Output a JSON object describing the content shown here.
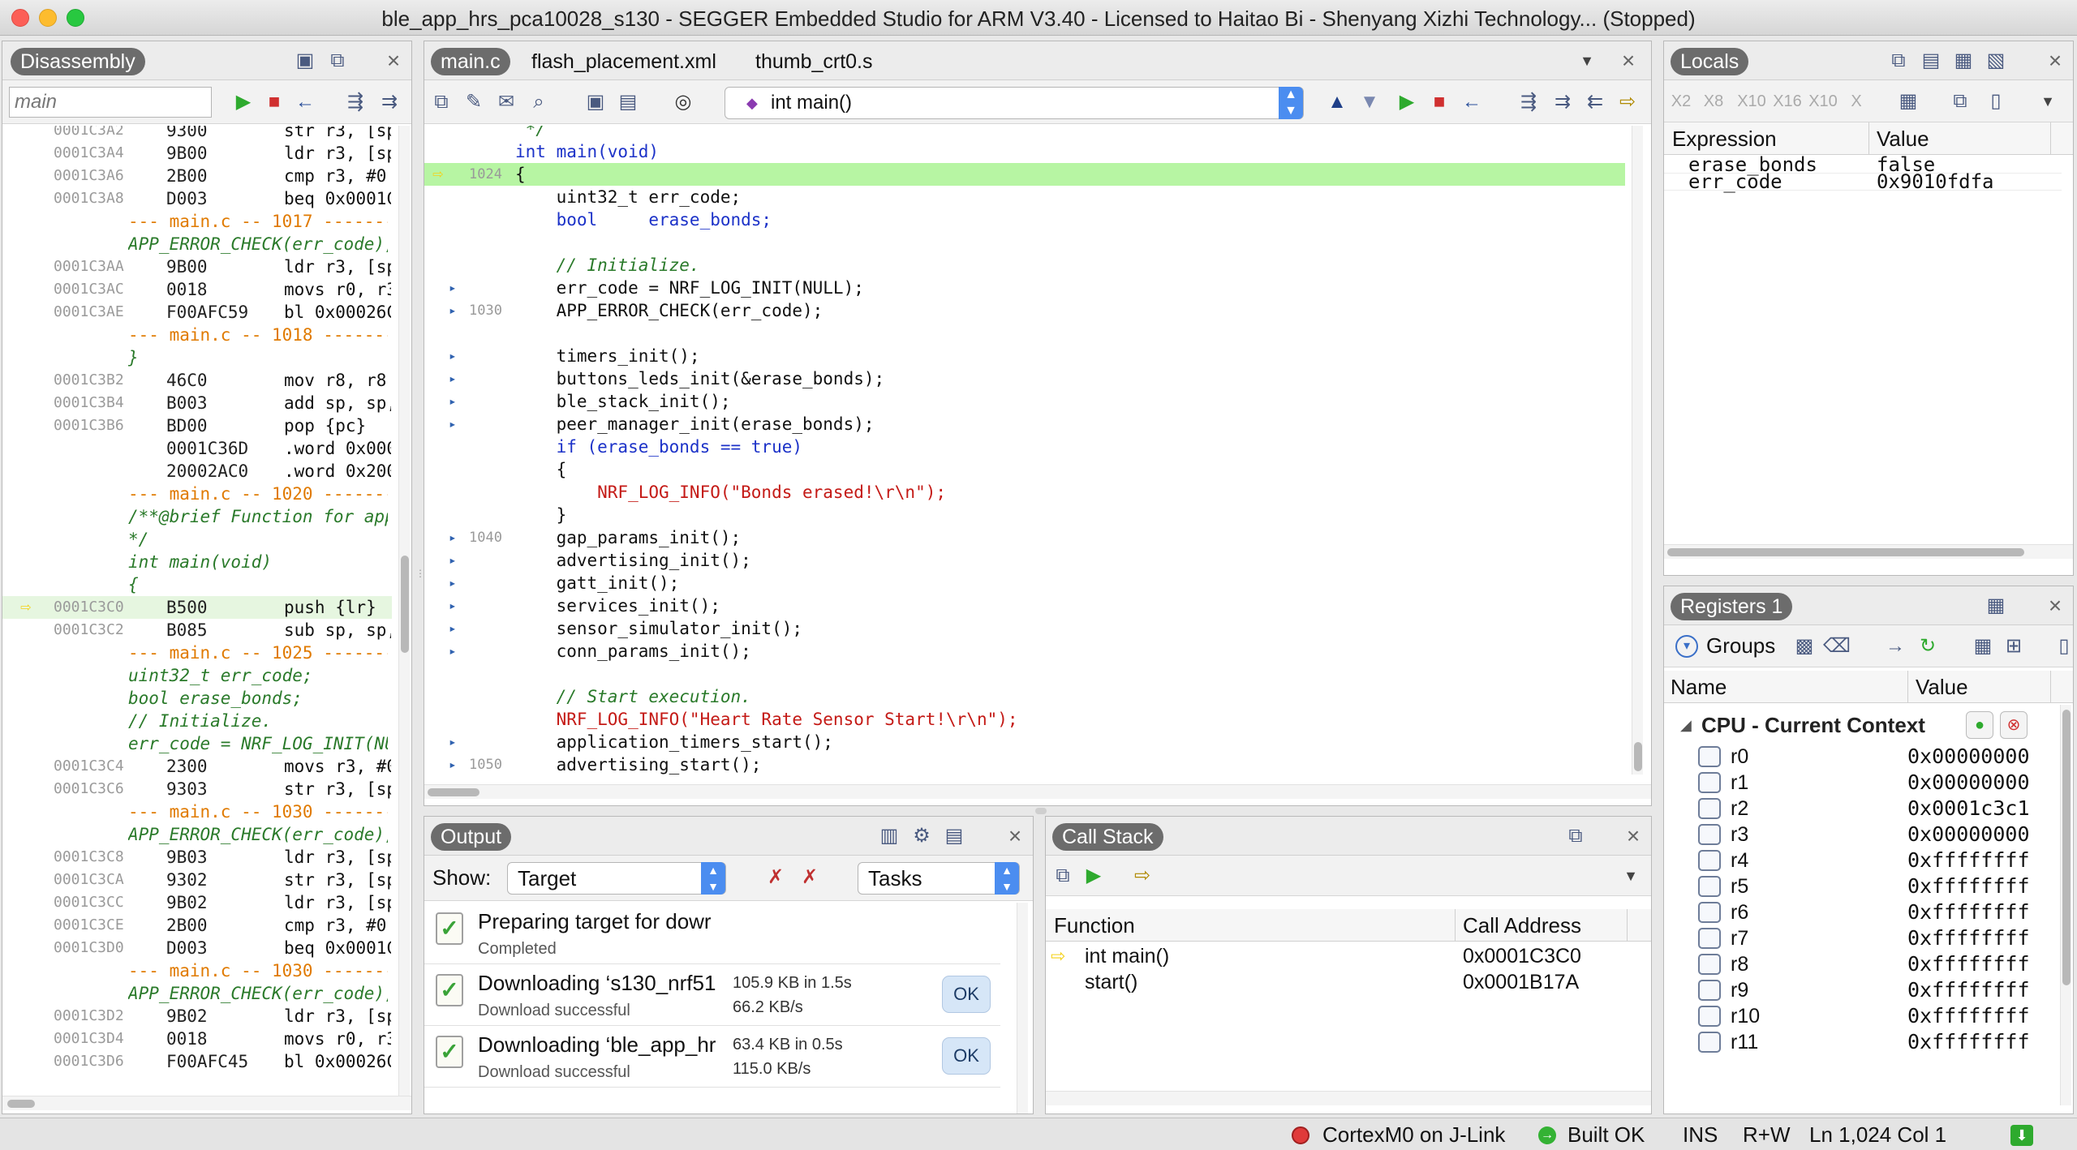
{
  "window": {
    "title": "ble_app_hrs_pca10028_s130 - SEGGER Embedded Studio for ARM V3.40 - Licensed to Haitao Bi - Shenyang Xizhi Technology... (Stopped)"
  },
  "disassembly": {
    "tab": "Disassembly",
    "search_value": "main",
    "rows": [
      {
        "kind": "code",
        "addr": "0001C3A2",
        "hex": "9300",
        "ins": "str r3, [sp"
      },
      {
        "kind": "code",
        "addr": "0001C3A4",
        "hex": "9B00",
        "ins": "ldr r3, [sp"
      },
      {
        "kind": "code",
        "addr": "0001C3A6",
        "hex": "2B00",
        "ins": "cmp r3, #0"
      },
      {
        "kind": "code",
        "addr": "0001C3A8",
        "hex": "D003",
        "ins": "beq 0x0001C"
      },
      {
        "kind": "sep",
        "text": "--- main.c -- 1017 ---------"
      },
      {
        "kind": "src",
        "text": "APP_ERROR_CHECK(err_code);"
      },
      {
        "kind": "code",
        "addr": "0001C3AA",
        "hex": "9B00",
        "ins": "ldr r3, [sp"
      },
      {
        "kind": "code",
        "addr": "0001C3AC",
        "hex": "0018",
        "ins": "movs r0, r3"
      },
      {
        "kind": "code",
        "addr": "0001C3AE",
        "hex": "F00AFC59",
        "ins": "bl 0x00026C"
      },
      {
        "kind": "sep",
        "text": "--- main.c -- 1018 ---------"
      },
      {
        "kind": "src",
        "text": "}"
      },
      {
        "kind": "code",
        "addr": "0001C3B2",
        "hex": "46C0",
        "ins": "mov r8, r8"
      },
      {
        "kind": "code",
        "addr": "0001C3B4",
        "hex": "B003",
        "ins": "add sp, sp,"
      },
      {
        "kind": "code",
        "addr": "0001C3B6",
        "hex": "BD00",
        "ins": "pop {pc}"
      },
      {
        "kind": "code",
        "addr": "",
        "hex": "0001C36D",
        "ins": ".word 0x000"
      },
      {
        "kind": "code",
        "addr": "",
        "hex": "20002AC0",
        "ins": ".word 0x200"
      },
      {
        "kind": "sep",
        "text": "--- main.c -- 1020 ---------"
      },
      {
        "kind": "src",
        "text": "/**@brief Function for appl"
      },
      {
        "kind": "src",
        "text": "*/"
      },
      {
        "kind": "src",
        "text": "int main(void)"
      },
      {
        "kind": "src",
        "text": "{"
      },
      {
        "kind": "code",
        "addr": "0001C3C0",
        "hex": "B500",
        "ins": "push {lr}",
        "current": true
      },
      {
        "kind": "code",
        "addr": "0001C3C2",
        "hex": "B085",
        "ins": "sub sp, sp,"
      },
      {
        "kind": "sep",
        "text": "--- main.c -- 1025 ---------"
      },
      {
        "kind": "src",
        "text": "uint32_t err_code;"
      },
      {
        "kind": "src",
        "text": "bool erase_bonds;"
      },
      {
        "kind": "src",
        "text": "// Initialize."
      },
      {
        "kind": "src",
        "text": "err_code = NRF_LOG_INIT(NUL"
      },
      {
        "kind": "code",
        "addr": "0001C3C4",
        "hex": "2300",
        "ins": "movs r3, #0"
      },
      {
        "kind": "code",
        "addr": "0001C3C6",
        "hex": "9303",
        "ins": "str r3, [sp"
      },
      {
        "kind": "sep",
        "text": "--- main.c -- 1030 ---------"
      },
      {
        "kind": "src",
        "text": "APP_ERROR_CHECK(err_code);"
      },
      {
        "kind": "code",
        "addr": "0001C3C8",
        "hex": "9B03",
        "ins": "ldr r3, [sp"
      },
      {
        "kind": "code",
        "addr": "0001C3CA",
        "hex": "9302",
        "ins": "str r3, [sp"
      },
      {
        "kind": "code",
        "addr": "0001C3CC",
        "hex": "9B02",
        "ins": "ldr r3, [sp"
      },
      {
        "kind": "code",
        "addr": "0001C3CE",
        "hex": "2B00",
        "ins": "cmp r3, #0"
      },
      {
        "kind": "code",
        "addr": "0001C3D0",
        "hex": "D003",
        "ins": "beq 0x0001C"
      },
      {
        "kind": "sep",
        "text": "--- main.c -- 1030 ---------"
      },
      {
        "kind": "src",
        "text": "APP_ERROR_CHECK(err_code);"
      },
      {
        "kind": "code",
        "addr": "0001C3D2",
        "hex": "9B02",
        "ins": "ldr r3, [sp"
      },
      {
        "kind": "code",
        "addr": "0001C3D4",
        "hex": "0018",
        "ins": "movs r0, r3"
      },
      {
        "kind": "code",
        "addr": "0001C3D6",
        "hex": "F00AFC45",
        "ins": "bl 0x00026C"
      }
    ]
  },
  "editor": {
    "tabs": [
      "main.c",
      "flash_placement.xml",
      "thumb_crt0.s"
    ],
    "function_selector": "int main()",
    "lines": [
      {
        "ln": "",
        "mark": "",
        "code": " */"
      },
      {
        "ln": "",
        "mark": "",
        "code": "int main(void)"
      },
      {
        "ln": "1024",
        "mark": "pc",
        "code": "{"
      },
      {
        "ln": "",
        "mark": "",
        "code": "    uint32_t err_code;"
      },
      {
        "ln": "",
        "mark": "",
        "code": "    bool     erase_bonds;"
      },
      {
        "ln": "",
        "mark": "",
        "code": ""
      },
      {
        "ln": "",
        "mark": "",
        "code": "    // Initialize."
      },
      {
        "ln": "",
        "mark": "bp",
        "code": "    err_code = NRF_LOG_INIT(NULL);"
      },
      {
        "ln": "1030",
        "mark": "bp",
        "code": "    APP_ERROR_CHECK(err_code);"
      },
      {
        "ln": "",
        "mark": "",
        "code": ""
      },
      {
        "ln": "",
        "mark": "bp",
        "code": "    timers_init();"
      },
      {
        "ln": "",
        "mark": "bp",
        "code": "    buttons_leds_init(&erase_bonds);"
      },
      {
        "ln": "",
        "mark": "bp",
        "code": "    ble_stack_init();"
      },
      {
        "ln": "",
        "mark": "bp",
        "code": "    peer_manager_init(erase_bonds);"
      },
      {
        "ln": "",
        "mark": "",
        "code": "    if (erase_bonds == true)"
      },
      {
        "ln": "",
        "mark": "",
        "code": "    {"
      },
      {
        "ln": "",
        "mark": "",
        "code": "        NRF_LOG_INFO(\"Bonds erased!\\r\\n\");"
      },
      {
        "ln": "",
        "mark": "",
        "code": "    }"
      },
      {
        "ln": "1040",
        "mark": "bp",
        "code": "    gap_params_init();"
      },
      {
        "ln": "",
        "mark": "bp",
        "code": "    advertising_init();"
      },
      {
        "ln": "",
        "mark": "bp",
        "code": "    gatt_init();"
      },
      {
        "ln": "",
        "mark": "bp",
        "code": "    services_init();"
      },
      {
        "ln": "",
        "mark": "bp",
        "code": "    sensor_simulator_init();"
      },
      {
        "ln": "",
        "mark": "bp",
        "code": "    conn_params_init();"
      },
      {
        "ln": "",
        "mark": "",
        "code": ""
      },
      {
        "ln": "",
        "mark": "",
        "code": "    // Start execution."
      },
      {
        "ln": "",
        "mark": "",
        "code": "    NRF_LOG_INFO(\"Heart Rate Sensor Start!\\r\\n\");"
      },
      {
        "ln": "",
        "mark": "bp",
        "code": "    application_timers_start();"
      },
      {
        "ln": "1050",
        "mark": "bp",
        "code": "    advertising_start();"
      }
    ]
  },
  "locals": {
    "tab": "Locals",
    "col_expression": "Expression",
    "col_value": "Value",
    "rows": [
      {
        "name": "erase_bonds",
        "value": "false"
      },
      {
        "name": "err_code",
        "value": "0x9010fdfa"
      }
    ],
    "format_buttons": [
      "X2",
      "X8",
      "X10",
      "X16",
      "X10",
      "X"
    ]
  },
  "registers": {
    "tab": "Registers 1",
    "groups_label": "Groups",
    "col_name": "Name",
    "col_value": "Value",
    "group_title": "CPU - Current Context",
    "rows": [
      {
        "name": "r0",
        "value": "0x00000000"
      },
      {
        "name": "r1",
        "value": "0x00000000"
      },
      {
        "name": "r2",
        "value": "0x0001c3c1"
      },
      {
        "name": "r3",
        "value": "0x00000000"
      },
      {
        "name": "r4",
        "value": "0xffffffff"
      },
      {
        "name": "r5",
        "value": "0xffffffff"
      },
      {
        "name": "r6",
        "value": "0xffffffff"
      },
      {
        "name": "r7",
        "value": "0xffffffff"
      },
      {
        "name": "r8",
        "value": "0xffffffff"
      },
      {
        "name": "r9",
        "value": "0xffffffff"
      },
      {
        "name": "r10",
        "value": "0xffffffff"
      },
      {
        "name": "r11",
        "value": "0xffffffff"
      }
    ]
  },
  "output": {
    "tab": "Output",
    "show_label": "Show:",
    "show_value": "Target",
    "tasks_value": "Tasks",
    "items": [
      {
        "title": "Preparing target for dowr",
        "sub": "Completed",
        "meta1": "",
        "meta2": "",
        "ok": ""
      },
      {
        "title": "Downloading ‘s130_nrf51",
        "sub": "Download successful",
        "meta1": "105.9 KB in 1.5s",
        "meta2": "66.2 KB/s",
        "ok": "OK"
      },
      {
        "title": "Downloading ‘ble_app_hr",
        "sub": "Download successful",
        "meta1": "63.4 KB in 0.5s",
        "meta2": "115.0 KB/s",
        "ok": "OK"
      }
    ]
  },
  "callstack": {
    "tab": "Call Stack",
    "col_function": "Function",
    "col_address": "Call Address",
    "rows": [
      {
        "func": "int main()",
        "addr": "0x0001C3C0",
        "current": true
      },
      {
        "func": "start()",
        "addr": "0x0001B17A",
        "current": false
      }
    ]
  },
  "status": {
    "target": "CortexM0 on J-Link",
    "build": "Built OK",
    "ins": "INS",
    "rw": "R+W",
    "position": "Ln 1,024 Col 1"
  },
  "colors": {
    "pc_line_bg": "#b7f5a3",
    "pc_arrow": "#f4d21a",
    "source_green": "#2a7a2a",
    "separator_orange": "#e07a00",
    "string_red": "#c41a16",
    "keyword_blue": "#1c32c8"
  }
}
